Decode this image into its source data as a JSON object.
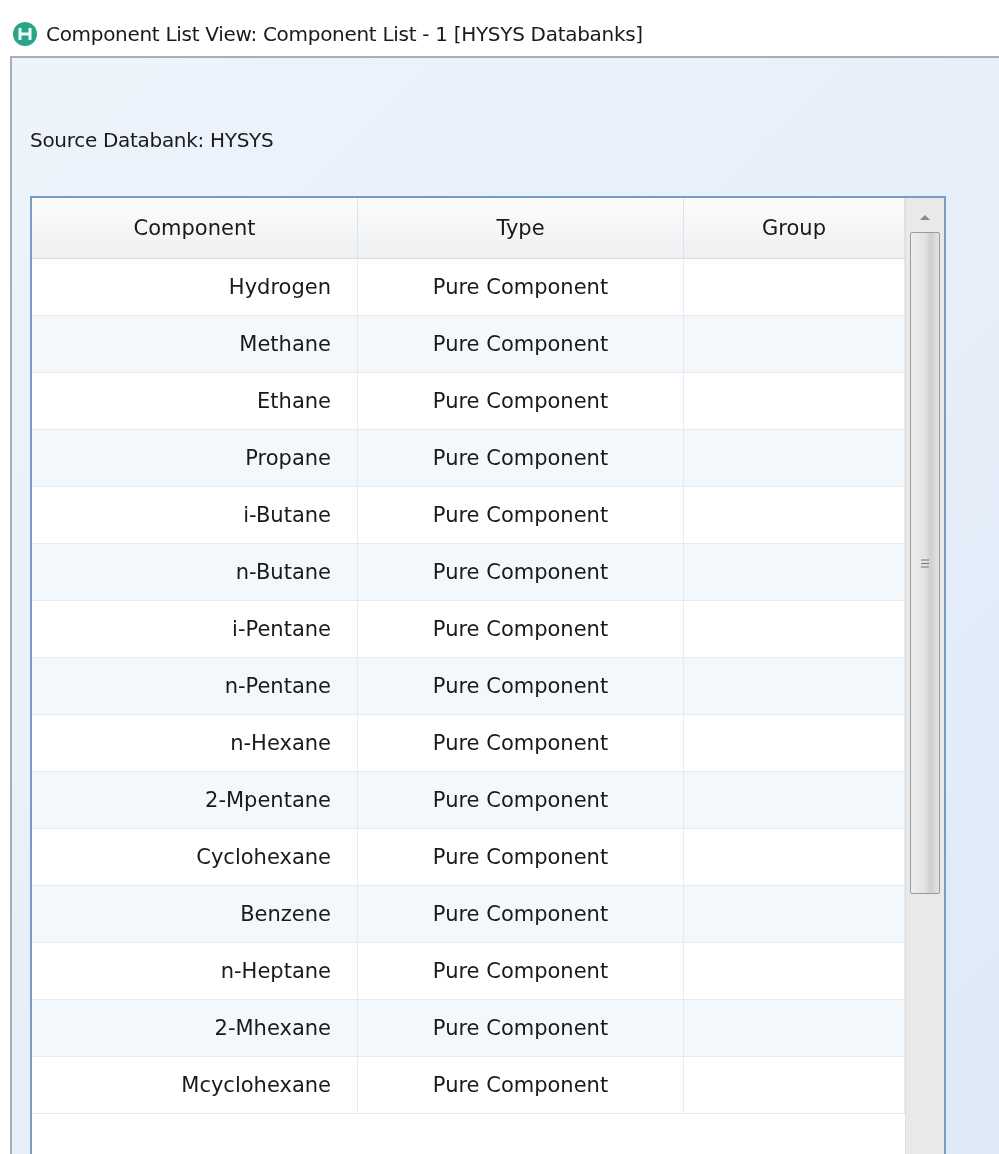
{
  "window": {
    "title": "Component List View: Component List - 1 [HYSYS Databanks]"
  },
  "source_label": "Source Databank: HYSYS",
  "table": {
    "columns": [
      "Component",
      "Type",
      "Group"
    ],
    "rows": [
      {
        "component": "Hydrogen",
        "type": "Pure Component",
        "group": ""
      },
      {
        "component": "Methane",
        "type": "Pure Component",
        "group": ""
      },
      {
        "component": "Ethane",
        "type": "Pure Component",
        "group": ""
      },
      {
        "component": "Propane",
        "type": "Pure Component",
        "group": ""
      },
      {
        "component": "i-Butane",
        "type": "Pure Component",
        "group": ""
      },
      {
        "component": "n-Butane",
        "type": "Pure Component",
        "group": ""
      },
      {
        "component": "i-Pentane",
        "type": "Pure Component",
        "group": ""
      },
      {
        "component": "n-Pentane",
        "type": "Pure Component",
        "group": ""
      },
      {
        "component": "n-Hexane",
        "type": "Pure Component",
        "group": ""
      },
      {
        "component": "2-Mpentane",
        "type": "Pure Component",
        "group": ""
      },
      {
        "component": "Cyclohexane",
        "type": "Pure Component",
        "group": ""
      },
      {
        "component": "Benzene",
        "type": "Pure Component",
        "group": ""
      },
      {
        "component": "n-Heptane",
        "type": "Pure Component",
        "group": ""
      },
      {
        "component": "2-Mhexane",
        "type": "Pure Component",
        "group": ""
      },
      {
        "component": "Mcyclohexane",
        "type": "Pure Component",
        "group": ""
      }
    ]
  }
}
